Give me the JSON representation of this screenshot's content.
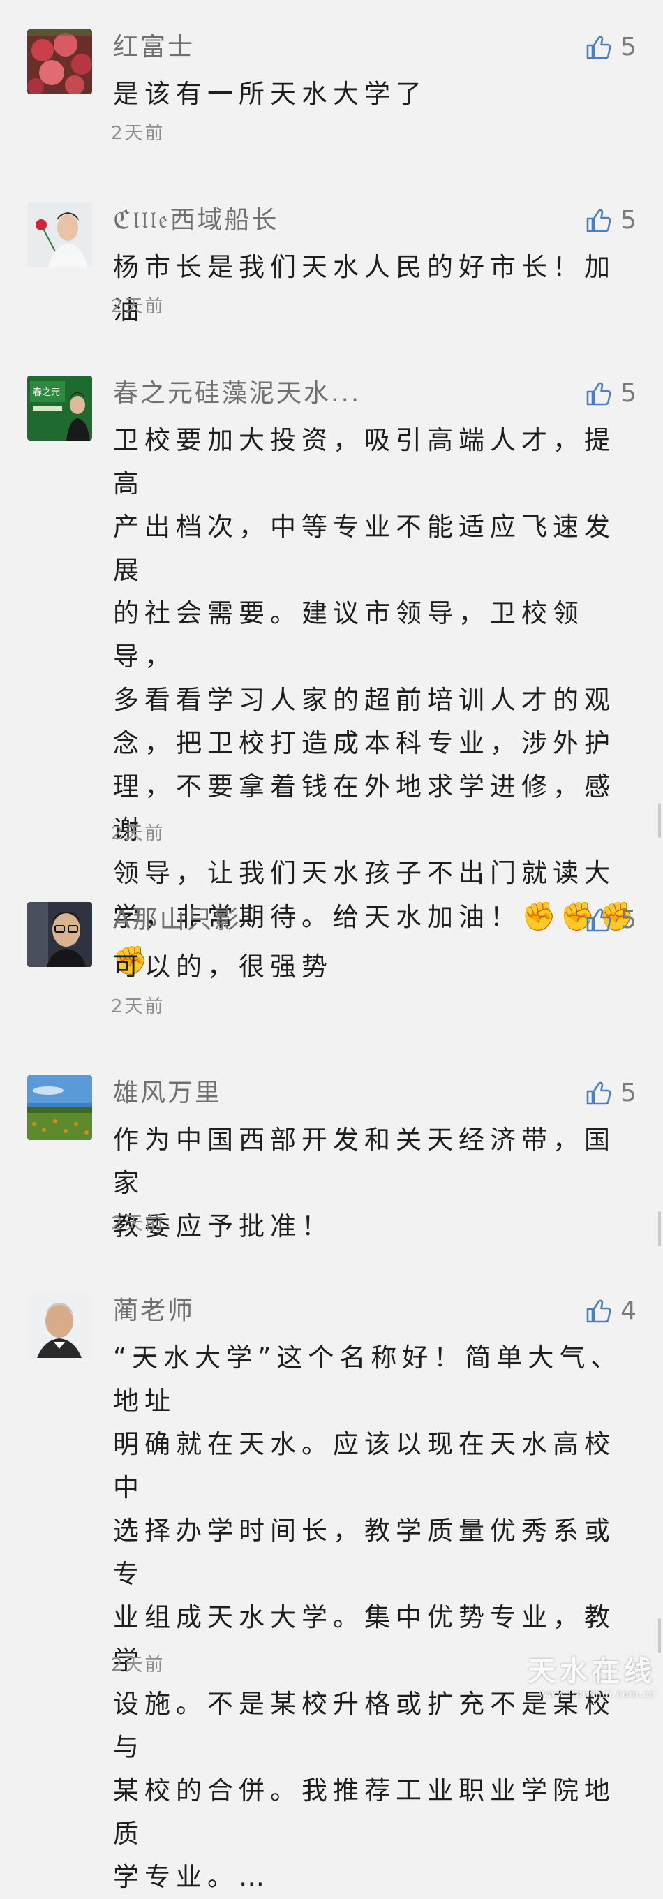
{
  "comments": [
    {
      "nickname": "红富士",
      "content": "是该有一所天水大学了",
      "likes": "5",
      "time": "2天前",
      "avatar_icon": "apples-photo-avatar"
    },
    {
      "nickname": "ℭ𝔩𝔩𝔩𝔢西域船长",
      "content": "杨市长是我们天水人民的好市长！加油",
      "likes": "5",
      "time": "2天前",
      "avatar_icon": "man-with-rose-avatar"
    },
    {
      "nickname": "春之元硅藻泥天水...",
      "content": "卫校要加大投资，吸引高端人才，提高\n产出档次，中等专业不能适应飞速发展\n的社会需要。建议市领导，卫校领导，\n多看看学习人家的超前培训人才的观\n念，把卫校打造成本科专业，涉外护\n理，不要拿着钱在外地求学进修，感谢\n领导，让我们天水孩子不出门就读大\n学，非常期待。给天水加油！",
      "emoji": "✊✊✊",
      "emoji_2": "✊",
      "likes": "5",
      "time": "2天前",
      "avatar_icon": "green-brand-avatar",
      "avatar_text": "春之元"
    },
    {
      "nickname": "A那山只影",
      "content": "可以的，很强势",
      "likes": "5",
      "time": "2天前",
      "avatar_icon": "man-with-glasses-avatar"
    },
    {
      "nickname": "雄风万里",
      "content": "作为中国西部开发和关天经济带，国家\n教委应予批准！",
      "likes": "5",
      "time": "2天前",
      "avatar_icon": "field-landscape-avatar"
    },
    {
      "nickname": "蔺老师",
      "content": "“天水大学”这个名称好！简单大气、地址\n明确就在天水。应该以现在天水高校中\n选择办学时间长，教学质量优秀系或专\n业组成天水大学。集中优势专业，教学\n设施。不是某校升格或扩充不是某校与\n某校的合併。我推荐工业职业学院地质\n学专业。…",
      "likes": "4",
      "time": "2天前",
      "avatar_icon": "older-man-avatar"
    }
  ],
  "watermark": {
    "text": "天水在线",
    "url": "www.tianshui.com.cn"
  },
  "colors": {
    "background": "#f2f2f2",
    "thumb_blue": "#4a7fc1",
    "nickname": "#707070",
    "time": "#8e8e8e"
  }
}
